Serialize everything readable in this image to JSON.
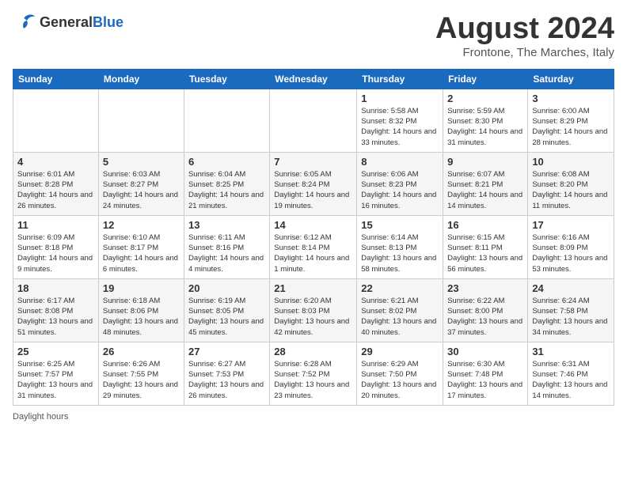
{
  "header": {
    "logo": {
      "general": "General",
      "blue": "Blue"
    },
    "title": "August 2024",
    "location": "Frontone, The Marches, Italy"
  },
  "weekdays": [
    "Sunday",
    "Monday",
    "Tuesday",
    "Wednesday",
    "Thursday",
    "Friday",
    "Saturday"
  ],
  "weeks": [
    [
      {
        "day": "",
        "info": ""
      },
      {
        "day": "",
        "info": ""
      },
      {
        "day": "",
        "info": ""
      },
      {
        "day": "",
        "info": ""
      },
      {
        "day": "1",
        "info": "Sunrise: 5:58 AM\nSunset: 8:32 PM\nDaylight: 14 hours and 33 minutes."
      },
      {
        "day": "2",
        "info": "Sunrise: 5:59 AM\nSunset: 8:30 PM\nDaylight: 14 hours and 31 minutes."
      },
      {
        "day": "3",
        "info": "Sunrise: 6:00 AM\nSunset: 8:29 PM\nDaylight: 14 hours and 28 minutes."
      }
    ],
    [
      {
        "day": "4",
        "info": "Sunrise: 6:01 AM\nSunset: 8:28 PM\nDaylight: 14 hours and 26 minutes."
      },
      {
        "day": "5",
        "info": "Sunrise: 6:03 AM\nSunset: 8:27 PM\nDaylight: 14 hours and 24 minutes."
      },
      {
        "day": "6",
        "info": "Sunrise: 6:04 AM\nSunset: 8:25 PM\nDaylight: 14 hours and 21 minutes."
      },
      {
        "day": "7",
        "info": "Sunrise: 6:05 AM\nSunset: 8:24 PM\nDaylight: 14 hours and 19 minutes."
      },
      {
        "day": "8",
        "info": "Sunrise: 6:06 AM\nSunset: 8:23 PM\nDaylight: 14 hours and 16 minutes."
      },
      {
        "day": "9",
        "info": "Sunrise: 6:07 AM\nSunset: 8:21 PM\nDaylight: 14 hours and 14 minutes."
      },
      {
        "day": "10",
        "info": "Sunrise: 6:08 AM\nSunset: 8:20 PM\nDaylight: 14 hours and 11 minutes."
      }
    ],
    [
      {
        "day": "11",
        "info": "Sunrise: 6:09 AM\nSunset: 8:18 PM\nDaylight: 14 hours and 9 minutes."
      },
      {
        "day": "12",
        "info": "Sunrise: 6:10 AM\nSunset: 8:17 PM\nDaylight: 14 hours and 6 minutes."
      },
      {
        "day": "13",
        "info": "Sunrise: 6:11 AM\nSunset: 8:16 PM\nDaylight: 14 hours and 4 minutes."
      },
      {
        "day": "14",
        "info": "Sunrise: 6:12 AM\nSunset: 8:14 PM\nDaylight: 14 hours and 1 minute."
      },
      {
        "day": "15",
        "info": "Sunrise: 6:14 AM\nSunset: 8:13 PM\nDaylight: 13 hours and 58 minutes."
      },
      {
        "day": "16",
        "info": "Sunrise: 6:15 AM\nSunset: 8:11 PM\nDaylight: 13 hours and 56 minutes."
      },
      {
        "day": "17",
        "info": "Sunrise: 6:16 AM\nSunset: 8:09 PM\nDaylight: 13 hours and 53 minutes."
      }
    ],
    [
      {
        "day": "18",
        "info": "Sunrise: 6:17 AM\nSunset: 8:08 PM\nDaylight: 13 hours and 51 minutes."
      },
      {
        "day": "19",
        "info": "Sunrise: 6:18 AM\nSunset: 8:06 PM\nDaylight: 13 hours and 48 minutes."
      },
      {
        "day": "20",
        "info": "Sunrise: 6:19 AM\nSunset: 8:05 PM\nDaylight: 13 hours and 45 minutes."
      },
      {
        "day": "21",
        "info": "Sunrise: 6:20 AM\nSunset: 8:03 PM\nDaylight: 13 hours and 42 minutes."
      },
      {
        "day": "22",
        "info": "Sunrise: 6:21 AM\nSunset: 8:02 PM\nDaylight: 13 hours and 40 minutes."
      },
      {
        "day": "23",
        "info": "Sunrise: 6:22 AM\nSunset: 8:00 PM\nDaylight: 13 hours and 37 minutes."
      },
      {
        "day": "24",
        "info": "Sunrise: 6:24 AM\nSunset: 7:58 PM\nDaylight: 13 hours and 34 minutes."
      }
    ],
    [
      {
        "day": "25",
        "info": "Sunrise: 6:25 AM\nSunset: 7:57 PM\nDaylight: 13 hours and 31 minutes."
      },
      {
        "day": "26",
        "info": "Sunrise: 6:26 AM\nSunset: 7:55 PM\nDaylight: 13 hours and 29 minutes."
      },
      {
        "day": "27",
        "info": "Sunrise: 6:27 AM\nSunset: 7:53 PM\nDaylight: 13 hours and 26 minutes."
      },
      {
        "day": "28",
        "info": "Sunrise: 6:28 AM\nSunset: 7:52 PM\nDaylight: 13 hours and 23 minutes."
      },
      {
        "day": "29",
        "info": "Sunrise: 6:29 AM\nSunset: 7:50 PM\nDaylight: 13 hours and 20 minutes."
      },
      {
        "day": "30",
        "info": "Sunrise: 6:30 AM\nSunset: 7:48 PM\nDaylight: 13 hours and 17 minutes."
      },
      {
        "day": "31",
        "info": "Sunrise: 6:31 AM\nSunset: 7:46 PM\nDaylight: 13 hours and 14 minutes."
      }
    ]
  ],
  "footer": {
    "daylight_label": "Daylight hours"
  }
}
